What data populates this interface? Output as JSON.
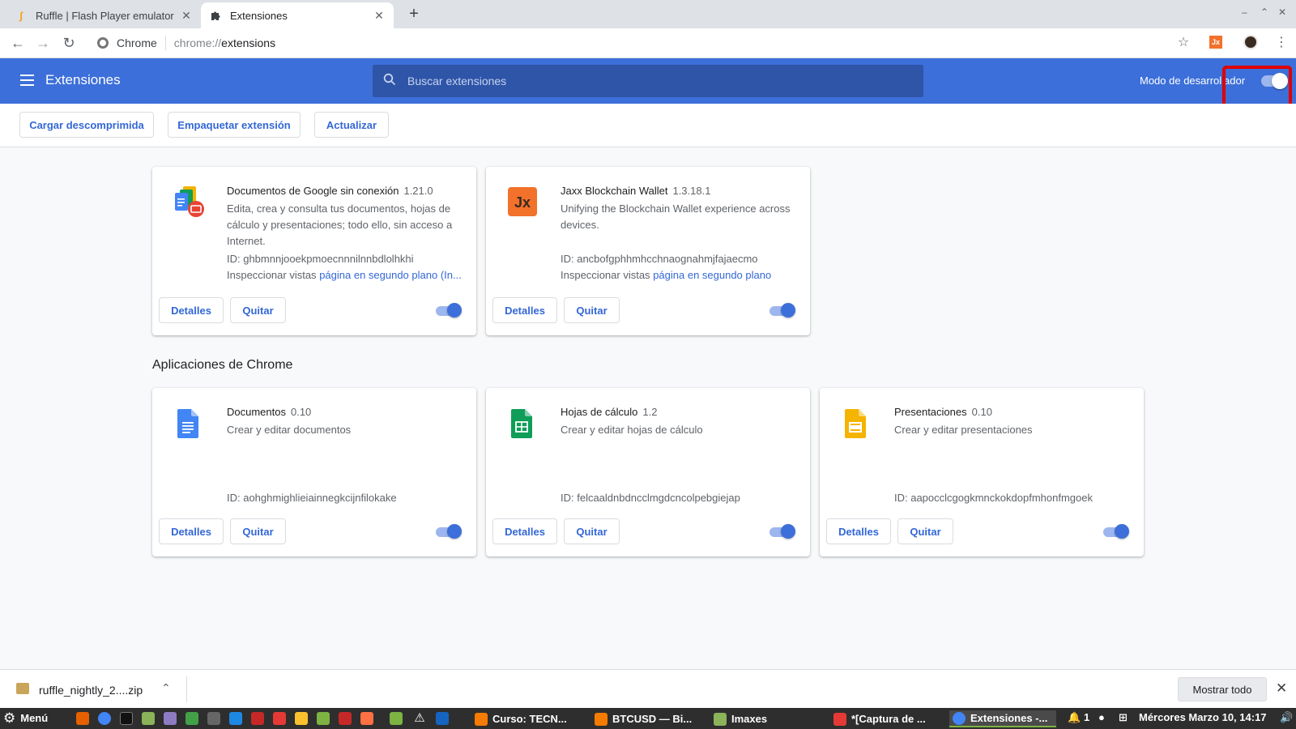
{
  "browser": {
    "tabs": [
      {
        "title": "Ruffle | Flash Player emulator",
        "icon": "ruffle-icon",
        "active": false
      },
      {
        "title": "Extensiones",
        "icon": "puzzle-icon",
        "active": true
      }
    ],
    "site_name": "Chrome",
    "url_scheme": "chrome://",
    "url_host": "extensions"
  },
  "header": {
    "title": "Extensiones",
    "search_placeholder": "Buscar extensiones",
    "devmode_label": "Modo de desarrollador",
    "devmode_on": true
  },
  "devbar": {
    "load_unpacked": "Cargar descomprimida",
    "pack": "Empaquetar extensión",
    "update": "Actualizar"
  },
  "extensions": [
    {
      "name": "Documentos de Google sin conexión",
      "version": "1.21.0",
      "description": "Edita, crea y consulta tus documentos, hojas de cálculo y presentaciones; todo ello, sin acceso a Internet.",
      "id_text": "ID: ghbmnnjooekpmoecnnnilnnbdlolhkhi",
      "inspect_label": "Inspeccionar vistas",
      "inspect_link": "página en segundo plano (In...",
      "details": "Detalles",
      "remove": "Quitar",
      "enabled": true
    },
    {
      "name": "Jaxx Blockchain Wallet",
      "version": "1.3.18.1",
      "description": "Unifying the Blockchain Wallet experience across devices.",
      "id_text": "ID: ancbofgphhmhcchnaognahmjfajaecmo",
      "inspect_label": "Inspeccionar vistas",
      "inspect_link": "página en segundo plano",
      "details": "Detalles",
      "remove": "Quitar",
      "enabled": true
    }
  ],
  "apps_section_title": "Aplicaciones de Chrome",
  "apps": [
    {
      "name": "Documentos",
      "version": "0.10",
      "description": "Crear y editar documentos",
      "id_text": "ID: aohghmighlieiainnegkcijnfilokake",
      "details": "Detalles",
      "remove": "Quitar",
      "enabled": true
    },
    {
      "name": "Hojas de cálculo",
      "version": "1.2",
      "description": "Crear y editar hojas de cálculo",
      "id_text": "ID: felcaaldnbdncclmgdcncolpebgiejap",
      "details": "Detalles",
      "remove": "Quitar",
      "enabled": true
    },
    {
      "name": "Presentaciones",
      "version": "0.10",
      "description": "Crear y editar presentaciones",
      "id_text": "ID: aapocclcgogkmnckokdopfmhonfmgoek",
      "details": "Detalles",
      "remove": "Quitar",
      "enabled": true
    }
  ],
  "download": {
    "filename": "ruffle_nightly_2....zip",
    "show_all": "Mostrar todo"
  },
  "taskbar": {
    "menu_label": "Menú",
    "windows": [
      {
        "title": "Curso: TECN...",
        "active": false
      },
      {
        "title": "BTCUSD — Bi...",
        "active": false
      },
      {
        "title": "Imaxes",
        "active": false
      },
      {
        "title": "*[Captura de ...",
        "active": false
      },
      {
        "title": "Extensiones -...",
        "active": true
      }
    ],
    "notif_count": "1",
    "clock": "Mércores Marzo 10, 14:17"
  },
  "colors": {
    "header_blue": "#3c6fd9",
    "link_blue": "#3367d6",
    "highlight_red": "#e00000"
  }
}
